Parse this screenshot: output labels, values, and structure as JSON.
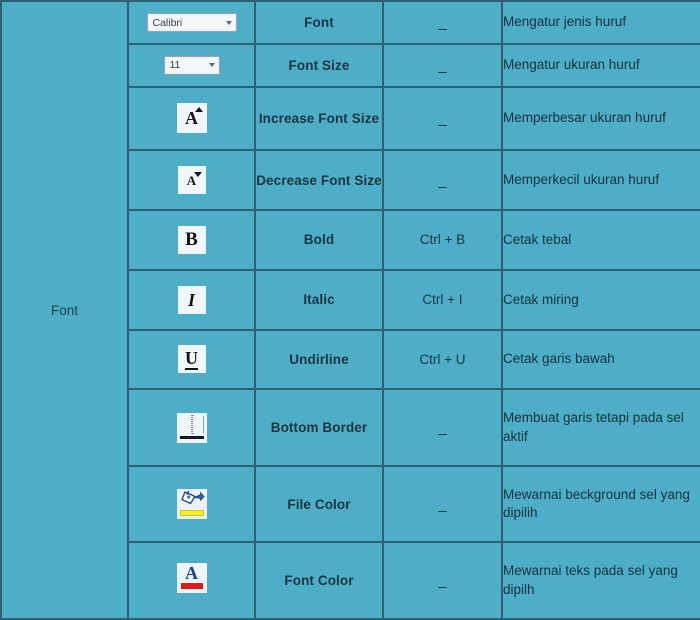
{
  "table": {
    "group_label": "Font",
    "rows": [
      {
        "icon": "font-name-combobox",
        "icon_value": "Calibri",
        "name": "Font",
        "shortcut": "_",
        "description": "Mengatur jenis huruf"
      },
      {
        "icon": "font-size-combobox",
        "icon_value": "11",
        "name": "Font Size",
        "shortcut": "_",
        "description": "Mengatur ukuran huruf"
      },
      {
        "icon": "increase-font-size-icon",
        "icon_value": "A",
        "name": "Increase Font Size",
        "shortcut": "_",
        "description": "Memperbesar ukuran huruf"
      },
      {
        "icon": "decrease-font-size-icon",
        "icon_value": "A",
        "name": "Decrease Font Size",
        "shortcut": "_",
        "description": "Memperkecil ukuran huruf"
      },
      {
        "icon": "bold-icon",
        "icon_value": "B",
        "name": "Bold",
        "shortcut": "Ctrl + B",
        "description": "Cetak tebal"
      },
      {
        "icon": "italic-icon",
        "icon_value": "I",
        "name": "Italic",
        "shortcut": "Ctrl + I",
        "description": "Cetak miring"
      },
      {
        "icon": "underline-icon",
        "icon_value": "U",
        "name": "Undirline",
        "shortcut": "Ctrl + U",
        "description": "Cetak garis bawah"
      },
      {
        "icon": "bottom-border-icon",
        "icon_value": "",
        "name": "Bottom Border",
        "shortcut": "_",
        "description": "Membuat garis tetapi pada sel aktif"
      },
      {
        "icon": "fill-color-icon",
        "icon_value": "",
        "name": "File Color",
        "shortcut": "_",
        "description": " Mewarnai beckground sel yang dipilih"
      },
      {
        "icon": "font-color-icon",
        "icon_value": "A",
        "name": "Font Color",
        "shortcut": "_",
        "description": "Mewarnai teks pada sel yang dipilh"
      }
    ]
  },
  "colors": {
    "cell_background": "#4FAEC7",
    "grid_line": "#2E5F73",
    "text": "#1b2a38",
    "font_color_accent": "#E0181C",
    "fill_color_accent": "#F6F02C",
    "font_color_letter": "#20427E"
  }
}
